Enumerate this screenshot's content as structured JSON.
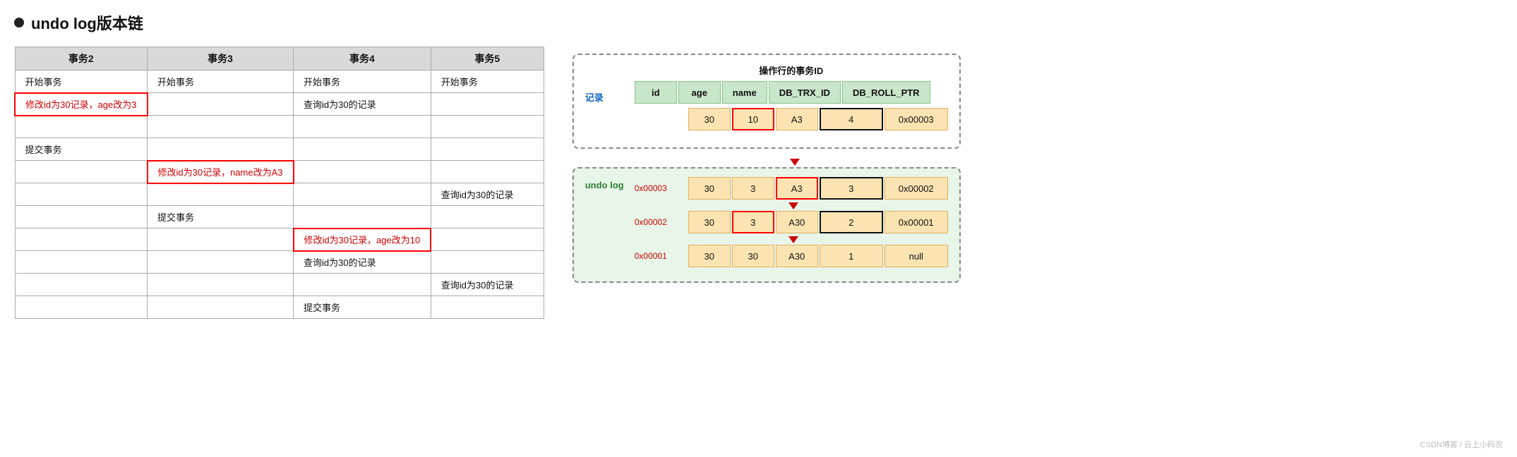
{
  "title": {
    "bullet": "●",
    "text": "undo log版本链"
  },
  "table": {
    "headers": [
      "事务2",
      "事务3",
      "事务4",
      "事务5"
    ],
    "rows": [
      [
        "开始事务",
        "开始事务",
        "开始事务",
        "开始事务"
      ],
      [
        "修改id为30记录，age改为3",
        "",
        "查询id为30的记录",
        ""
      ],
      [
        "",
        "",
        "",
        ""
      ],
      [
        "提交事务",
        "",
        "",
        ""
      ],
      [
        "",
        "修改id为30记录，name改为A3",
        "",
        ""
      ],
      [
        "",
        "",
        "",
        "查询id为30的记录"
      ],
      [
        "",
        "提交事务",
        "",
        ""
      ],
      [
        "",
        "",
        "修改id为30记录，age改为10",
        ""
      ],
      [
        "",
        "",
        "查询id为30的记录",
        ""
      ],
      [
        "",
        "",
        "",
        "查询id为30的记录"
      ],
      [
        "",
        "",
        "提交事务",
        ""
      ]
    ],
    "red_cells": [
      [
        1,
        0
      ],
      [
        4,
        1
      ],
      [
        7,
        2
      ]
    ]
  },
  "diagram": {
    "op_label": "操作行的事务ID",
    "record_label": "记录",
    "undolog_label": "undo log",
    "header_cols": [
      "id",
      "age",
      "name",
      "DB_TRX_ID",
      "DB_ROLL_PTR"
    ],
    "record_row": {
      "values": [
        "30",
        "10",
        "A3",
        "4",
        "0x00003"
      ],
      "red_cells": [
        1
      ],
      "black_cells": [
        3
      ]
    },
    "undo_rows": [
      {
        "addr": "0x00003",
        "values": [
          "30",
          "3",
          "A3",
          "3",
          "0x00002"
        ],
        "red_cells": [
          2
        ],
        "black_cells": [
          3
        ]
      },
      {
        "addr": "0x00002",
        "values": [
          "30",
          "3",
          "A30",
          "2",
          "0x00001"
        ],
        "red_cells": [
          1
        ],
        "black_cells": [
          3
        ]
      },
      {
        "addr": "0x00001",
        "values": [
          "30",
          "30",
          "A30",
          "1",
          "null"
        ],
        "red_cells": [],
        "black_cells": []
      }
    ]
  },
  "watermark": "CSDN博客 / 云上小码农"
}
